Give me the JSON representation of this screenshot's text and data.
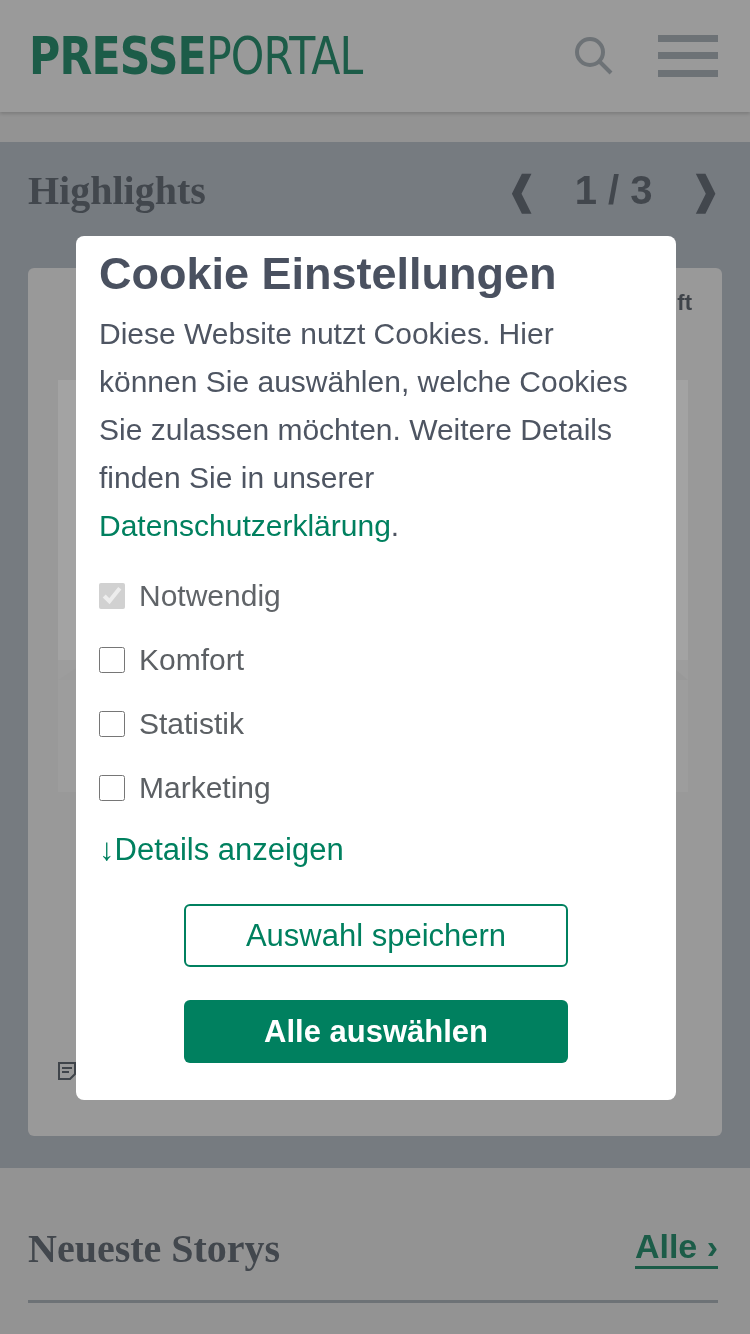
{
  "header": {
    "logo_bold": "PRESSE",
    "logo_light": "PORTAL"
  },
  "highlights": {
    "title": "Highlights",
    "prev": "❰",
    "pager": "1 / 3",
    "next": "❱",
    "card": {
      "source": "ft"
    }
  },
  "cookie_dialog": {
    "title": "Cookie Einstellungen",
    "text": "Diese Website nutzt Cookies. Hier können Sie auswählen, welche Cookies Sie zulassen möchten. Weitere Details finden Sie in unserer ",
    "link": "Datenschutzerklärung",
    "text_end": ".",
    "options": [
      {
        "label": "Notwendig",
        "checked": true,
        "disabled": true
      },
      {
        "label": "Komfort",
        "checked": false,
        "disabled": false
      },
      {
        "label": "Statistik",
        "checked": false,
        "disabled": false
      },
      {
        "label": "Marketing",
        "checked": false,
        "disabled": false
      }
    ],
    "details_link": "↓Details anzeigen",
    "save_button": "Auswahl speichern",
    "accept_button": "Alle auswählen"
  },
  "latest": {
    "title": "Neueste Storys",
    "all_link": "Alle ›"
  }
}
